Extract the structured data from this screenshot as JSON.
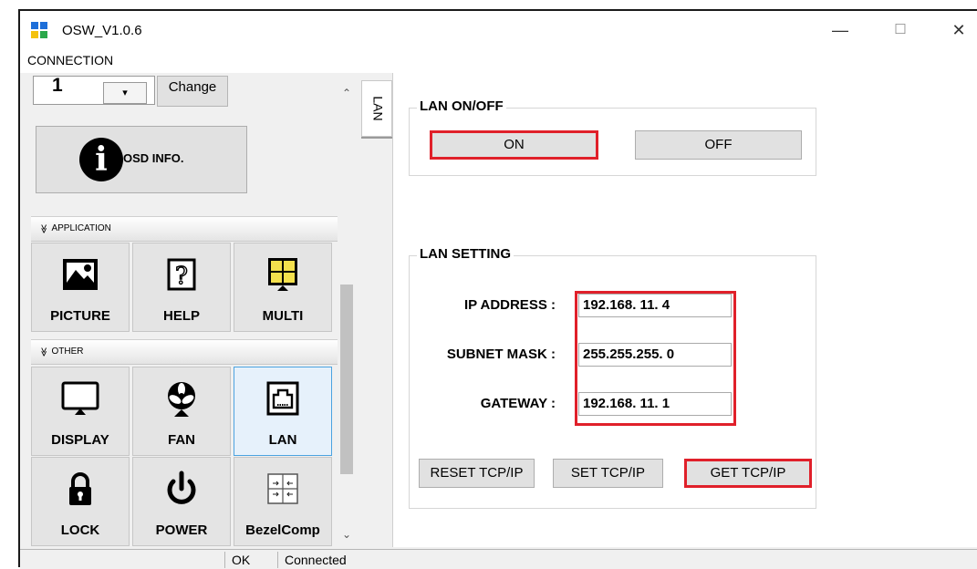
{
  "window": {
    "title": "OSW_V1.0.6",
    "minimize_glyph": "—",
    "maximize_glyph": "☐",
    "close_glyph": "✕"
  },
  "menu": {
    "items": [
      "CONNECTION"
    ]
  },
  "left": {
    "spinner_value": "1",
    "spinner_arrow": "▾",
    "change_label": "Change",
    "osd_label": "OSD INFO.",
    "osd_glyph": "i",
    "sections": {
      "application": {
        "header": "APPLICATION",
        "tiles": [
          {
            "label": "PICTURE",
            "icon": "picture-icon"
          },
          {
            "label": "HELP",
            "icon": "help-icon"
          },
          {
            "label": "MULTI",
            "icon": "multi-icon"
          }
        ]
      },
      "other": {
        "header": "OTHER",
        "tiles": [
          {
            "label": "DISPLAY",
            "icon": "display-icon"
          },
          {
            "label": "FAN",
            "icon": "fan-icon"
          },
          {
            "label": "LAN",
            "icon": "lan-icon",
            "selected": true
          },
          {
            "label": "LOCK",
            "icon": "lock-icon"
          },
          {
            "label": "POWER",
            "icon": "power-icon"
          },
          {
            "label": "BezelComp",
            "icon": "bezel-icon"
          }
        ]
      }
    },
    "collapse_glyph": "≫",
    "scroll_up": "⌃",
    "scroll_down": "⌄"
  },
  "tabs": {
    "lan": "LAN"
  },
  "lan_onoff": {
    "title": "LAN ON/OFF",
    "on_label": "ON",
    "off_label": "OFF",
    "highlight_color": "#e0202a"
  },
  "lan_setting": {
    "title": "LAN SETTING",
    "ip_label": "IP ADDRESS :",
    "ip_value": "192.168. 11.  4",
    "subnet_label": "SUBNET MASK :",
    "subnet_value": "255.255.255.  0",
    "gateway_label": "GATEWAY :",
    "gateway_value": "192.168. 11.  1",
    "reset_label": "RESET TCP/IP",
    "set_label": "SET TCP/IP",
    "get_label": "GET TCP/IP"
  },
  "status": {
    "left": "OK",
    "right": "Connected"
  }
}
